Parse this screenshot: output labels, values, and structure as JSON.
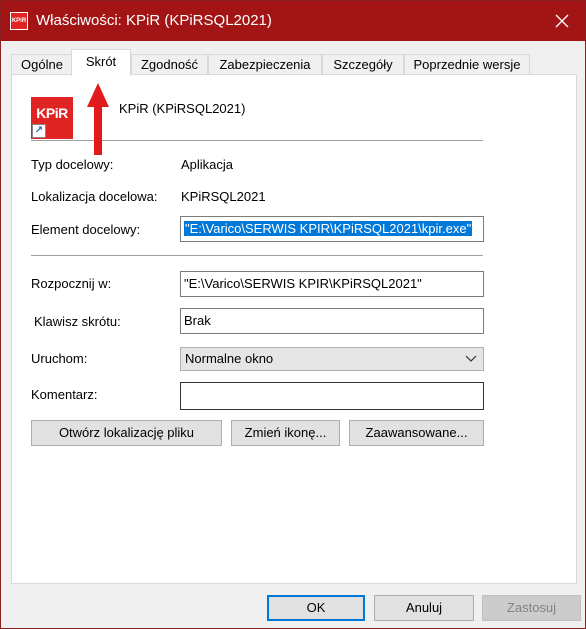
{
  "window": {
    "title": "Właściwości: KPiR (KPiRSQL2021)",
    "icon_label": "KPiR"
  },
  "tabs": [
    {
      "label": "Ogólne"
    },
    {
      "label": "Skrót"
    },
    {
      "label": "Zgodność"
    },
    {
      "label": "Zabezpieczenia"
    },
    {
      "label": "Szczegóły"
    },
    {
      "label": "Poprzednie wersje"
    }
  ],
  "active_tab": "Skrót",
  "app": {
    "icon_label": "KPiR",
    "name": "KPiR (KPiRSQL2021)"
  },
  "fields": {
    "target_type_label": "Typ docelowy:",
    "target_type_value": "Aplikacja",
    "target_location_label": "Lokalizacja docelowa:",
    "target_location_value": "KPiRSQL2021",
    "target_label": "Element docelowy:",
    "target_value": "\"E:\\Varico\\SERWIS KPIR\\KPiRSQL2021\\kpir.exe\"",
    "start_in_label": "Rozpocznij w:",
    "start_in_value": "\"E:\\Varico\\SERWIS KPIR\\KPiRSQL2021\"",
    "shortcut_key_label": "Klawisz skrótu:",
    "shortcut_key_value": "Brak",
    "run_label": "Uruchom:",
    "run_value": "Normalne okno",
    "comment_label": "Komentarz:",
    "comment_value": ""
  },
  "buttons": {
    "open_location": "Otwórz lokalizację pliku",
    "change_icon": "Zmień ikonę...",
    "advanced": "Zaawansowane...",
    "ok": "OK",
    "cancel": "Anuluj",
    "apply": "Zastosuj"
  },
  "colors": {
    "titlebar": "#a31515",
    "accent": "#0078d7",
    "annotation_arrow": "#e01b1b"
  }
}
